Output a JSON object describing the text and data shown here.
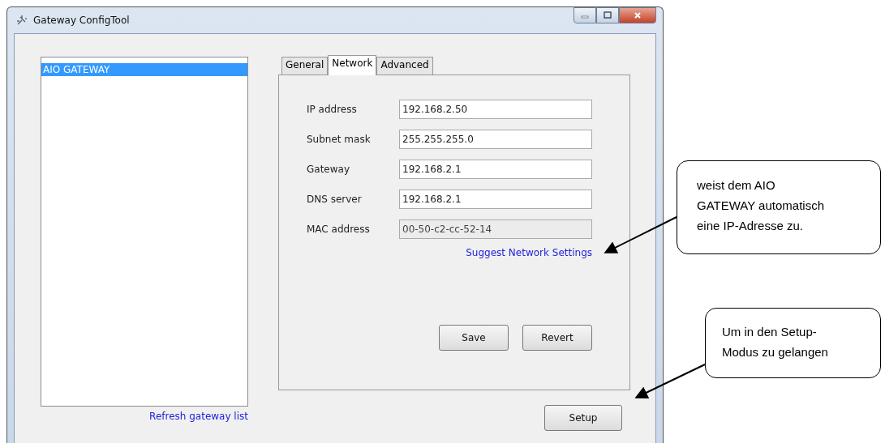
{
  "window": {
    "title": "Gateway ConfigTool"
  },
  "gateway_list": {
    "items": [
      {
        "label": "AIO GATEWAY",
        "selected": true
      }
    ],
    "refresh_link": "Refresh gateway list"
  },
  "tabs": [
    {
      "label": "General",
      "selected": false
    },
    {
      "label": "Network",
      "selected": true
    },
    {
      "label": "Advanced",
      "selected": false
    }
  ],
  "network": {
    "fields": [
      {
        "label": "IP address",
        "value": "192.168.2.50",
        "disabled": false
      },
      {
        "label": "Subnet mask",
        "value": "255.255.255.0",
        "disabled": false
      },
      {
        "label": "Gateway",
        "value": "192.168.2.1",
        "disabled": false
      },
      {
        "label": "DNS server",
        "value": "192.168.2.1",
        "disabled": false
      },
      {
        "label": "MAC address",
        "value": "00-50-c2-cc-52-14",
        "disabled": true
      }
    ],
    "suggest_link": "Suggest Network Settings",
    "buttons": [
      "Save",
      "Revert"
    ]
  },
  "setup_button": "Setup",
  "callouts": [
    {
      "lines": [
        "weist dem AIO",
        "GATEWAY automatisch",
        "eine IP-Adresse zu."
      ]
    },
    {
      "lines": [
        "Um in den Setup-",
        "Modus zu gelangen"
      ]
    }
  ]
}
